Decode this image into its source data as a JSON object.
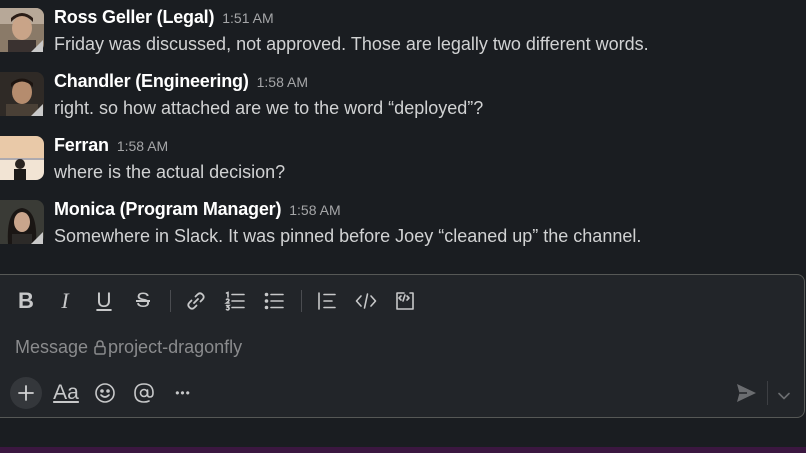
{
  "messages": [
    {
      "sender": "Ross Geller (Legal)",
      "time": "1:51 AM",
      "text": "Friday was discussed, not approved. Those are legally two different words."
    },
    {
      "sender": "Chandler (Engineering)",
      "time": "1:58 AM",
      "text": "right. so how attached are we to the word “deployed”?"
    },
    {
      "sender": "Ferran",
      "time": "1:58 AM",
      "text": "where is the actual decision?"
    },
    {
      "sender": "Monica (Program Manager)",
      "time": "1:58 AM",
      "text": "Somewhere in Slack. It was pinned before Joey “cleaned up” the channel."
    }
  ],
  "composer": {
    "placeholder_prefix": "Message",
    "channel": "project-dragonfly",
    "toolbar": {
      "bold": "B",
      "italic": "I",
      "underline": "U",
      "strike": "S"
    },
    "bottom": {
      "format_label": "Aa",
      "more_label": "•••"
    }
  },
  "colors": {
    "background": "#1a1d21",
    "composer_bg": "#222529",
    "accent_strip": "#3b1740"
  },
  "icons": [
    "link-icon",
    "ordered-list-icon",
    "bulleted-list-icon",
    "blockquote-icon",
    "code-icon",
    "code-block-icon",
    "plus-icon",
    "emoji-icon",
    "mention-icon",
    "send-icon",
    "chevron-down-icon",
    "lock-icon"
  ]
}
